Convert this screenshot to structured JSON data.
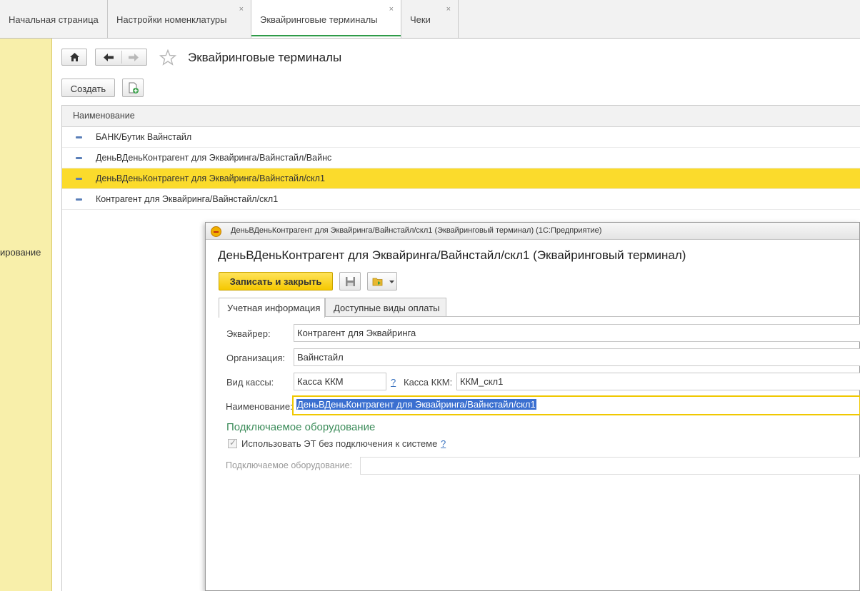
{
  "tabs": [
    {
      "label": "Начальная страница",
      "closable": false,
      "active": false
    },
    {
      "label": "Настройки номенклатуры",
      "closable": true,
      "active": false
    },
    {
      "label": "Эквайринговые терминалы",
      "closable": true,
      "active": true
    },
    {
      "label": "Чеки",
      "closable": true,
      "active": false
    }
  ],
  "close_glyph": "×",
  "sidebar": {
    "label": "ирование"
  },
  "main": {
    "title": "Эквайринговые терминалы",
    "create_label": "Создать",
    "column_header": "Наименование",
    "rows": [
      {
        "text": "БАНК/Бутик Вайнстайл",
        "selected": false
      },
      {
        "text": "ДеньВДеньКонтрагент для Эквайринга/Вайнстайл/Вайнс",
        "selected": false
      },
      {
        "text": "ДеньВДеньКонтрагент для Эквайринга/Вайнстайл/скл1",
        "selected": true
      },
      {
        "text": "Контрагент для Эквайринга/Вайнстайл/скл1",
        "selected": false
      }
    ]
  },
  "dialog": {
    "window_title": "ДеньВДеньКонтрагент для Эквайринга/Вайнстайл/скл1 (Эквайринговый терминал)  (1С:Предприятие)",
    "heading": "ДеньВДеньКонтрагент для Эквайринга/Вайнстайл/скл1 (Эквайринговый терминал)",
    "save_close_label": "Записать и закрыть",
    "tabs": [
      {
        "label": "Учетная информация",
        "active": true
      },
      {
        "label": "Доступные виды оплаты",
        "active": false
      }
    ],
    "fields": {
      "acquirer_label": "Эквайрер:",
      "acquirer_value": "Контрагент для Эквайринга",
      "organization_label": "Организация:",
      "organization_value": "Вайнстайл",
      "cash_type_label": "Вид кассы:",
      "cash_type_value": "Касса ККМ",
      "cash_register_label": "Касса ККМ:",
      "cash_register_value": "ККМ_скл1",
      "name_label": "Наименование:",
      "name_value": "ДеньВДеньКонтрагент для Эквайринга/Вайнстайл/скл1"
    },
    "help_glyph": "?",
    "section_title": "Подключаемое оборудование",
    "checkbox_label": "Использовать ЭТ без подключения к системе",
    "checkbox_checked": true,
    "equipment_label": "Подключаемое оборудование:",
    "equipment_value": ""
  },
  "colors": {
    "selected_row": "#fbdb2c",
    "primary_button": "#f5c800",
    "sidebar": "#f8efaa",
    "active_tab_underline": "#2e9b48",
    "section_title": "#3c8c5a"
  },
  "icons": [
    "home-icon",
    "back-arrow-icon",
    "forward-arrow-icon",
    "star-icon",
    "add-document-icon",
    "save-disk-icon",
    "folder-arrow-icon",
    "dropdown-arrow-icon",
    "1c-logo-icon"
  ]
}
